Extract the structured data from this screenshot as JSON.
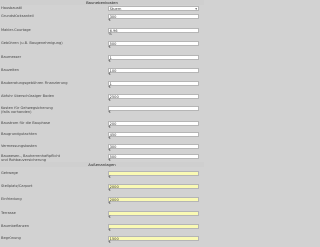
{
  "sections": {
    "construction_costs": "Baunebenkosten",
    "outdoor": "Außenanlagen"
  },
  "rows": [
    {
      "label": "Hausbaustil",
      "value": "Stuern",
      "unit": "",
      "type": "select"
    },
    {
      "label": "Grundstücksanteil",
      "value": "300",
      "unit": "€",
      "type": "input"
    },
    {
      "label": "Makler-Courtage",
      "value": "6,96",
      "unit": "%",
      "type": "input"
    },
    {
      "label": "Gebühren (u.B. Baugenehmigung)",
      "value": "500",
      "unit": "€",
      "type": "input"
    },
    {
      "label": "Baumesser",
      "value": "1",
      "unit": "€",
      "type": "input"
    },
    {
      "label": "Bauzeiten",
      "value": "100",
      "unit": "€",
      "type": "input"
    },
    {
      "label": "Bauberatungsgebühren Finanzierung",
      "value": "1",
      "unit": "€",
      "type": "input"
    },
    {
      "label": "Abfuhr überschüssiger Boden",
      "value": "2500",
      "unit": "€",
      "type": "input"
    },
    {
      "label": "Kosten für Gehwegsicherung\n(falls vorhanden)",
      "value": "",
      "unit": "€",
      "type": "input"
    },
    {
      "label": "Baustrom für die Bauphase",
      "value": "200",
      "unit": "€",
      "type": "input"
    },
    {
      "label": "Baugrundgutachten",
      "value": "450",
      "unit": "€",
      "type": "input"
    },
    {
      "label": "Vermessungskosten",
      "value": "300",
      "unit": "€",
      "type": "input"
    },
    {
      "label": "Bauwesen-, Bauherrenhaftpflicht\nund Rohbauversicherung",
      "value": "500",
      "unit": "€",
      "type": "input"
    },
    {
      "label": "Gehwege",
      "value": "",
      "unit": "€",
      "type": "input",
      "highlight": true
    },
    {
      "label": "Stellplatz/Carport",
      "value": "2000",
      "unit": "€",
      "type": "input",
      "highlight": true
    },
    {
      "label": "Einfriedung",
      "value": "2000",
      "unit": "€",
      "type": "input",
      "highlight": true
    },
    {
      "label": "Terrasse",
      "value": "",
      "unit": "€",
      "type": "input",
      "highlight": true
    },
    {
      "label": "Baumbeflanzen",
      "value": "",
      "unit": "€",
      "type": "input",
      "highlight": true
    },
    {
      "label": "Begrünung",
      "value": "1500",
      "unit": "€",
      "type": "input",
      "highlight": true
    }
  ]
}
